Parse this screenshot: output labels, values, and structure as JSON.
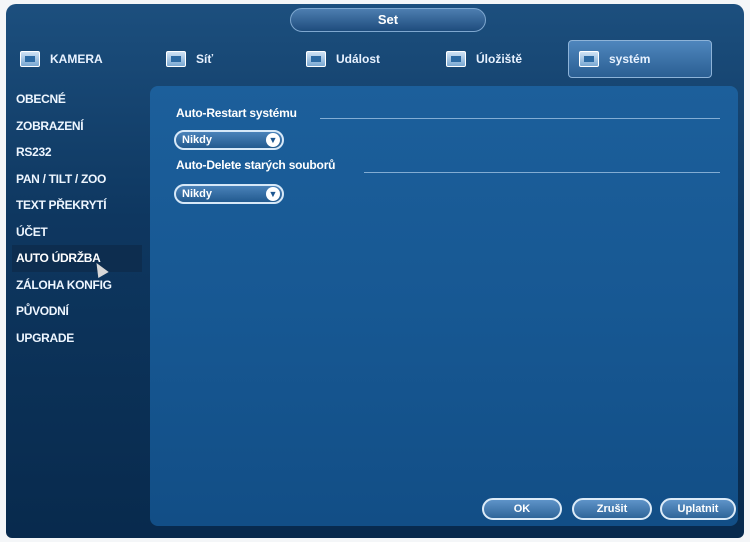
{
  "window": {
    "title": "Set"
  },
  "tabs": [
    {
      "label": "KAMERA",
      "icon": "camera-icon"
    },
    {
      "label": "Síť",
      "icon": "network-icon"
    },
    {
      "label": "Událost",
      "icon": "event-icon"
    },
    {
      "label": "Úložiště",
      "icon": "storage-icon"
    },
    {
      "label": "systém",
      "icon": "system-icon",
      "active": true
    }
  ],
  "sidebar": {
    "items": [
      {
        "label": "OBECNÉ"
      },
      {
        "label": "ZOBRAZENÍ"
      },
      {
        "label": "RS232"
      },
      {
        "label": "PAN / TILT / ZOO"
      },
      {
        "label": "TEXT PŘEKRYTÍ"
      },
      {
        "label": "ÚČET"
      },
      {
        "label": "AUTO ÚDRŽBA",
        "active": true
      },
      {
        "label": "ZÁLOHA KONFIG"
      },
      {
        "label": "PŮVODNÍ"
      },
      {
        "label": "UPGRADE"
      }
    ]
  },
  "form": {
    "auto_restart": {
      "label": "Auto-Restart systému",
      "value": "Nikdy"
    },
    "auto_delete": {
      "label": "Auto-Delete starých souborů",
      "value": "Nikdy"
    }
  },
  "buttons": {
    "ok": "OK",
    "cancel": "Zrušit",
    "apply": "Uplatnit"
  },
  "colors": {
    "accent": "#2b5f93",
    "panel": "#175893",
    "background": "#0e3760"
  }
}
